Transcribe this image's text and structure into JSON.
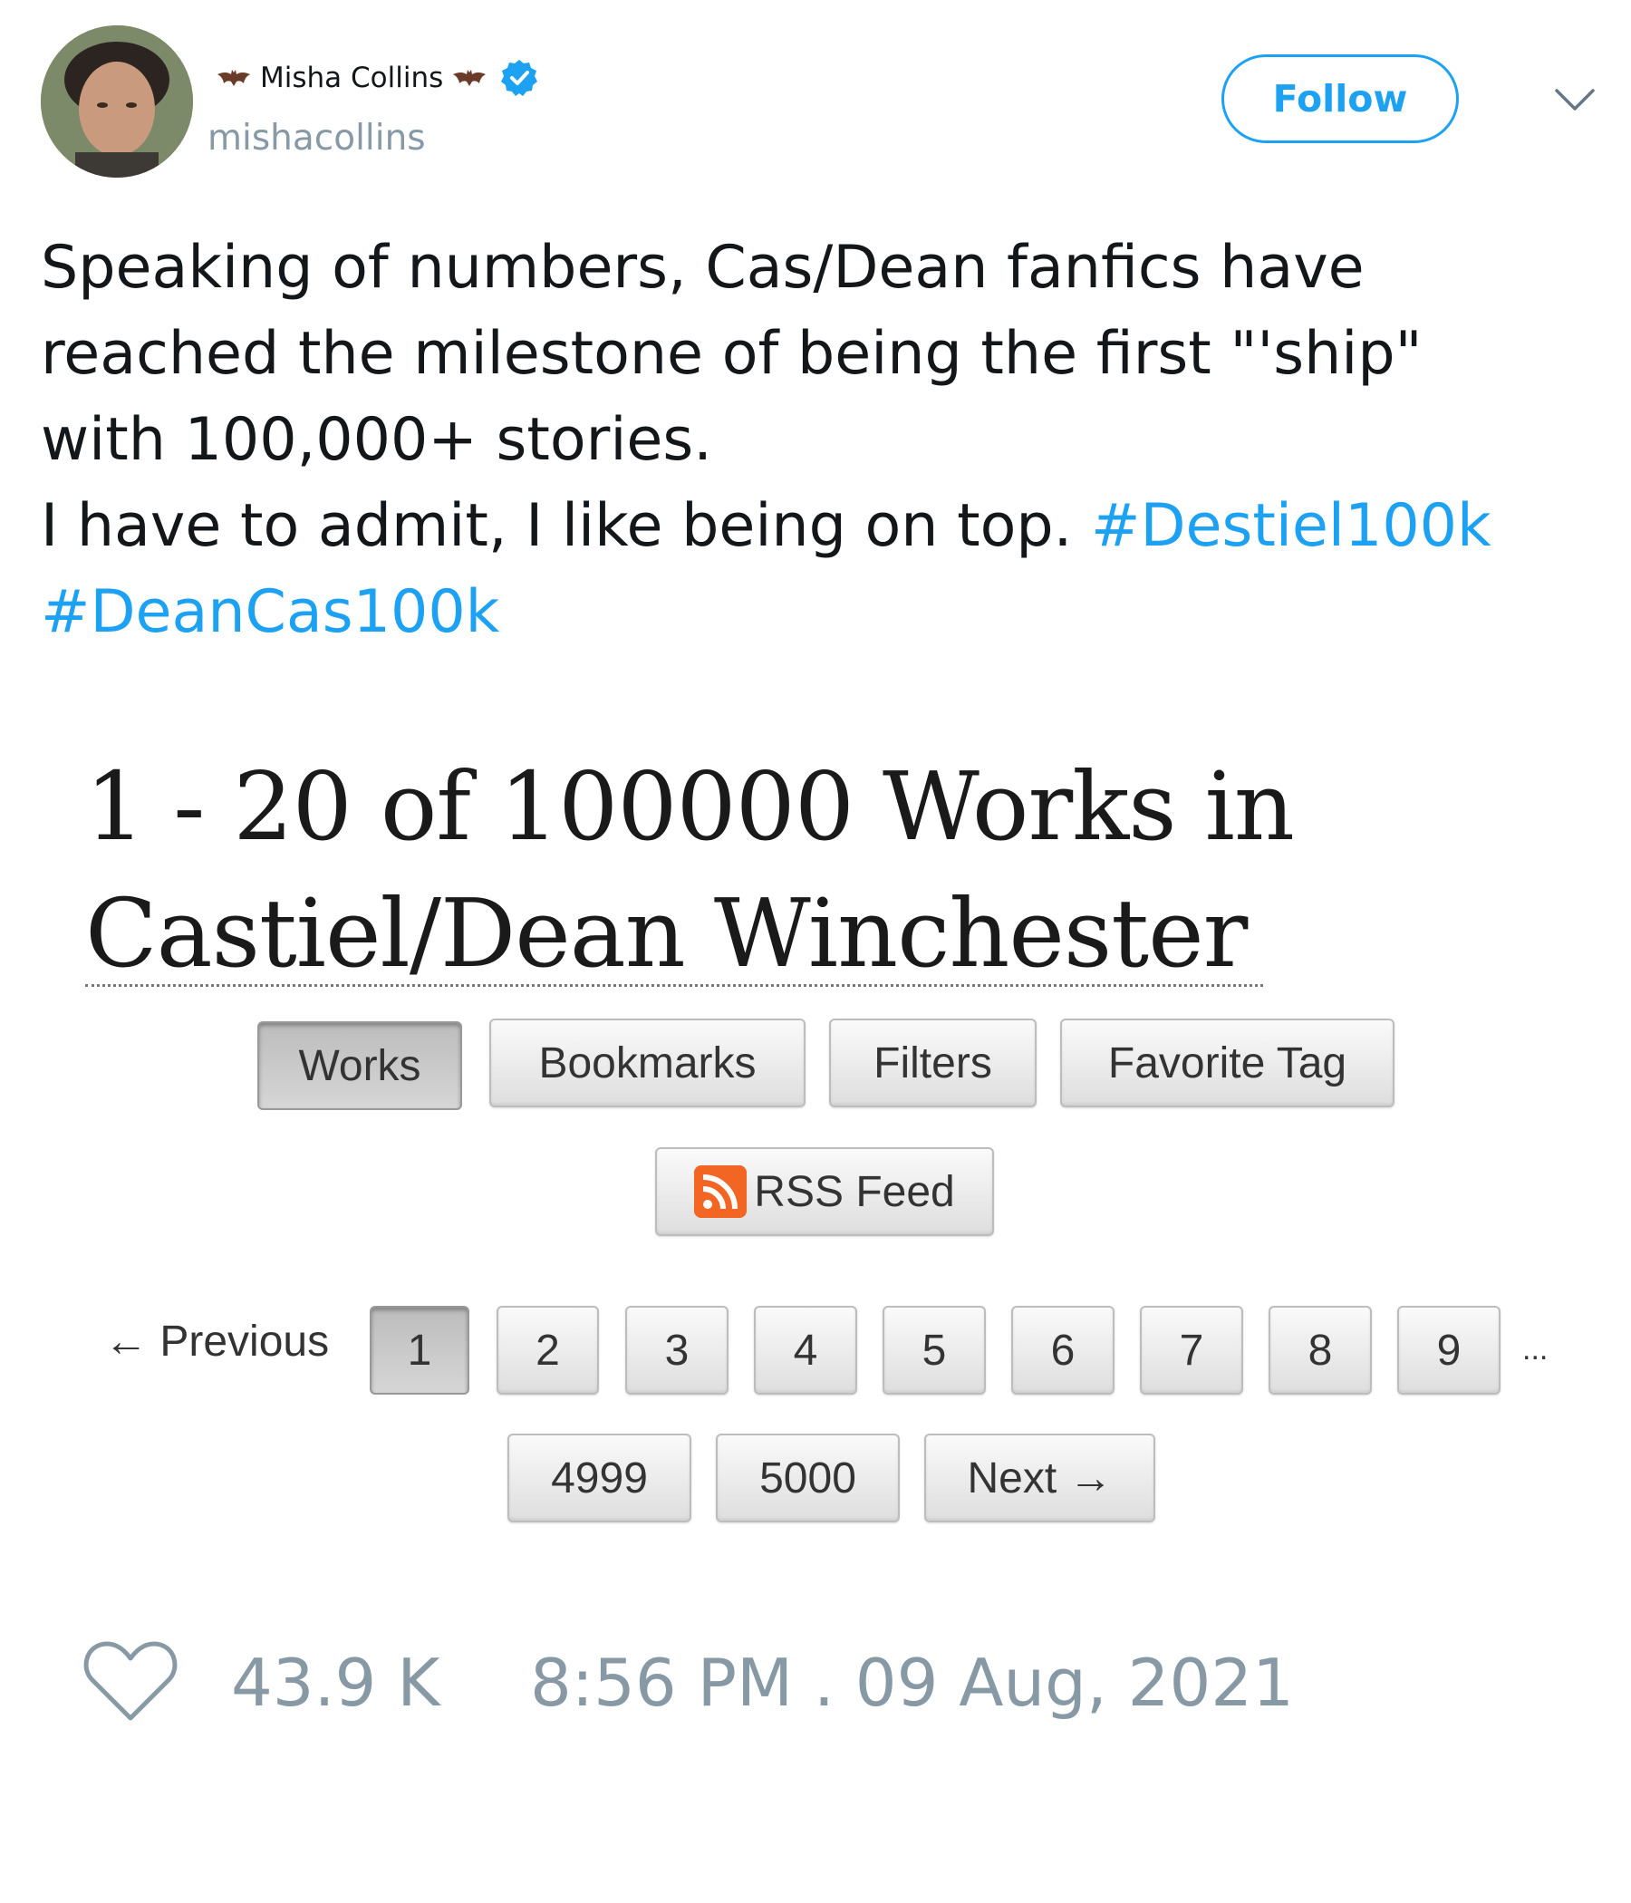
{
  "author": {
    "display_name": "Misha Collins",
    "handle": "mishacollins",
    "verified_icon": "verified-badge-icon",
    "decoration_icon": "bat-icon"
  },
  "header": {
    "follow_label": "Follow",
    "menu_icon": "chevron-down-icon"
  },
  "tweet": {
    "lines": [
      "Speaking of numbers, Cas/Dean fanfics have",
      "reached the milestone of being the first \"'ship\"",
      "with 100,000+ stories.",
      "I have to admit, I like being on top. "
    ],
    "hashtags": [
      "#Destiel100k",
      "#DeanCas100k"
    ]
  },
  "embedded_image": {
    "title_line1": "1 - 20 of 100000 Works in",
    "title_line2": "Castiel/Dean Winchester",
    "nav_buttons": [
      "Works",
      "Bookmarks",
      "Filters",
      "Favorite Tag"
    ],
    "active_nav": "Works",
    "rss_label": "RSS Feed",
    "rss_icon": "rss-icon",
    "pagination": {
      "previous_label": "← Previous",
      "pages": [
        "1",
        "2",
        "3",
        "4",
        "5",
        "6",
        "7",
        "8",
        "9"
      ],
      "current_page": "1",
      "ellipsis": "...",
      "last_pages": [
        "4999",
        "5000"
      ],
      "next_label": "Next →"
    }
  },
  "footer": {
    "like_icon": "heart-icon",
    "likes": "43.9 K",
    "timestamp": "8:56 PM . 09 Aug, 2021"
  },
  "colors": {
    "link_blue": "#1da1f2",
    "muted_gray": "#8899a6",
    "text": "#14171a"
  }
}
